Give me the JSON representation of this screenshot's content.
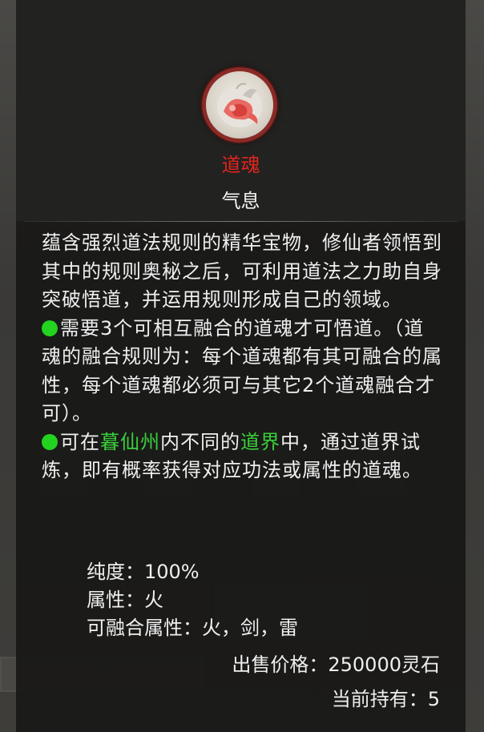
{
  "item": {
    "name": "道魂",
    "type": "气息",
    "icon": "fire-fish-icon",
    "name_color": "#e0241f"
  },
  "description": {
    "intro": "蕴含强烈道法规则的精华宝物，修仙者领悟到其中的规则奥秘之后，可利用道法之力助自身突破悟道，并运用规则形成自己的领域。",
    "rule1": "需要3个可相互融合的道魂才可悟道。（道魂的融合规则为：每个道魂都有其可融合的属性，每个道魂都必须可与其它2个道魂融合才可）。",
    "rule2_prefix": "可在",
    "rule2_place": "暮仙州",
    "rule2_middle": "内不同的",
    "rule2_realm": "道界",
    "rule2_suffix": "中，通过道界试炼，即有概率获得对应功法或属性的道魂。",
    "bullet_color": "#22d31f",
    "highlight_color": "#3ad13a"
  },
  "stats": {
    "purity": "纯度：100%",
    "attribute": "属性：火",
    "fusible": "可融合属性：火，剑，雷"
  },
  "footer": {
    "sell_price": "出售价格：250000灵石",
    "owned": "当前持有：5"
  }
}
